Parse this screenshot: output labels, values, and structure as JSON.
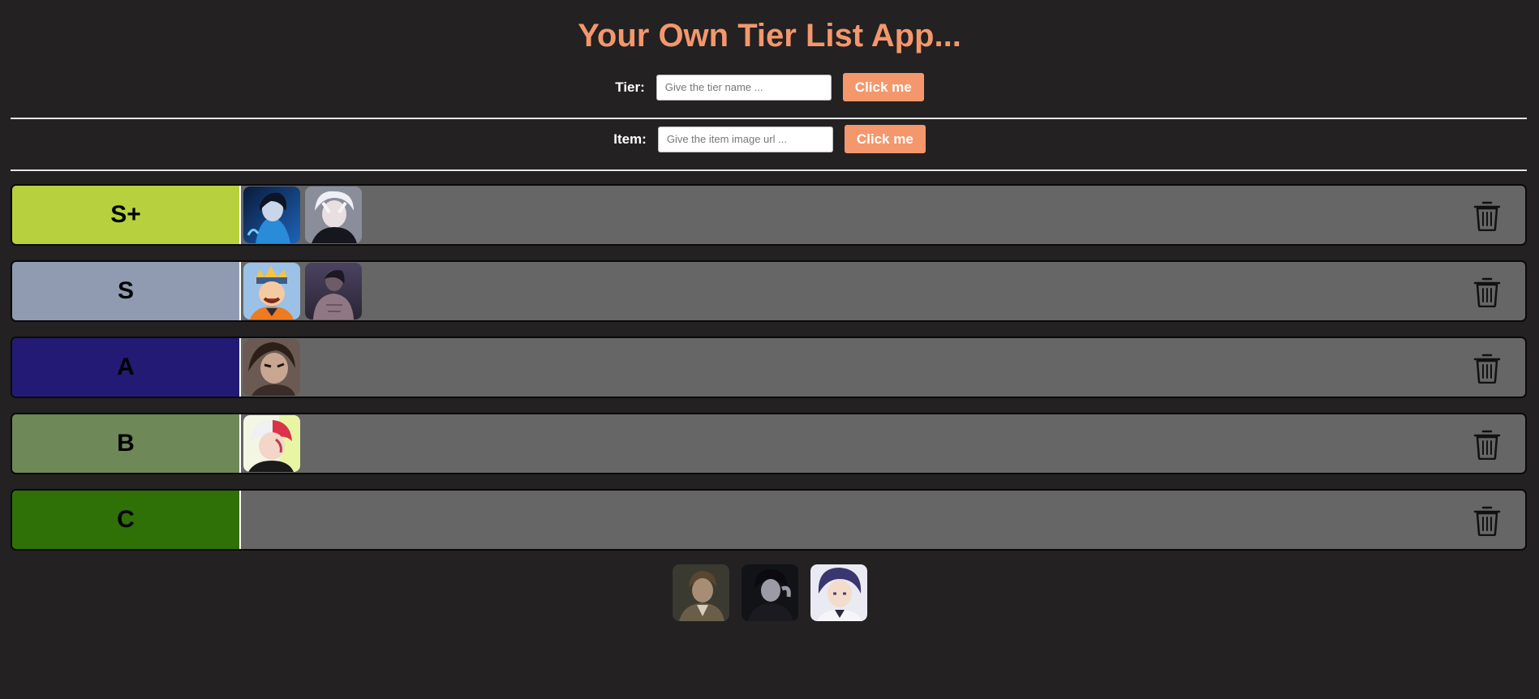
{
  "app": {
    "title": "Your Own Tier List App..."
  },
  "tier_form": {
    "label": "Tier:",
    "placeholder": "Give the tier name ...",
    "button": "Click me"
  },
  "item_form": {
    "label": "Item:",
    "placeholder": "Give the item image url ...",
    "button": "Click me"
  },
  "colors": {
    "accent": "#f4976c",
    "background": "#232122",
    "row": "#666666"
  },
  "tiers": [
    {
      "label": "S+",
      "color": "#b6d13d",
      "items": [
        "blue-hooded-character-image",
        "white-haired-character-image"
      ]
    },
    {
      "label": "S",
      "color": "#909bb2",
      "items": [
        "orange-ninja-character-image",
        "dark-shirtless-character-image"
      ]
    },
    {
      "label": "A",
      "color": "#231a75",
      "items": [
        "brown-haired-character-image"
      ]
    },
    {
      "label": "B",
      "color": "#6e8857",
      "items": [
        "red-white-haired-character-image"
      ]
    },
    {
      "label": "C",
      "color": "#2f7107",
      "items": []
    }
  ],
  "icons": {
    "delete": "trash-icon"
  },
  "unranked_items": [
    "brown-coat-character-image",
    "black-haired-character-image",
    "purple-haired-character-image"
  ]
}
